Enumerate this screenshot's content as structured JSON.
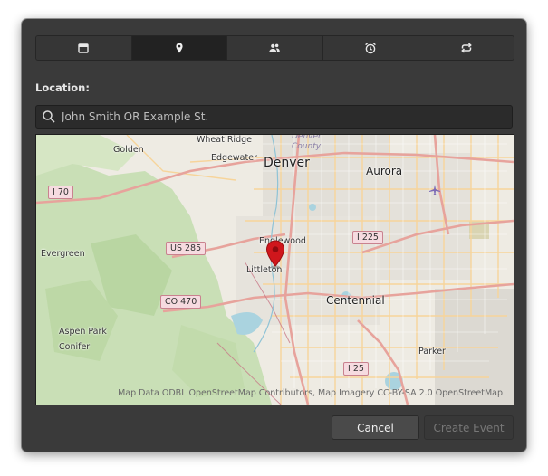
{
  "tabs": [
    {
      "name": "tab-date",
      "icon": "calendar-icon"
    },
    {
      "name": "tab-location",
      "icon": "map-pin-icon",
      "active": true
    },
    {
      "name": "tab-guests",
      "icon": "people-icon"
    },
    {
      "name": "tab-reminder",
      "icon": "alarm-clock-icon"
    },
    {
      "name": "tab-repeat",
      "icon": "repeat-icon"
    }
  ],
  "location": {
    "label": "Location:",
    "search_placeholder": "John Smith OR Example St."
  },
  "map": {
    "places": {
      "golden": "Golden",
      "wheat_ridge": "Wheat Ridge",
      "edgewater": "Edgewater",
      "denver": "Denver",
      "denver_county": "Denver\nCounty",
      "aurora": "Aurora",
      "evergreen": "Evergreen",
      "englewood": "Englewood",
      "littleton": "Littleton",
      "centennial": "Centennial",
      "aspen_park": "Aspen Park",
      "conifer": "Conifer",
      "parker": "Parker"
    },
    "shields": {
      "i70": "I 70",
      "us285": "US 285",
      "i225": "I 225",
      "co470": "CO 470",
      "i25": "I 25"
    },
    "attribution": "Map Data ODBL OpenStreetMap Contributors, Map Imagery CC-BY-SA 2.0 OpenStreetMap",
    "colors": {
      "pin": "#d0161c",
      "highway": "#e7a39c",
      "arterial": "#f7d49a",
      "park": "#c9dfb6",
      "water": "#aad3df"
    }
  },
  "buttons": {
    "cancel": "Cancel",
    "create": "Create Event"
  }
}
